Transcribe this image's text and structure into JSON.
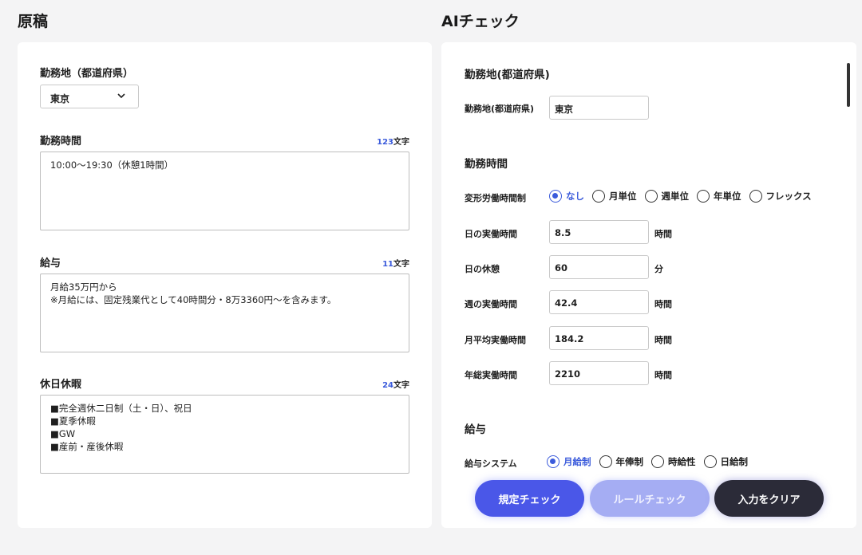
{
  "left": {
    "title": "原稿",
    "location": {
      "label": "勤務地（都道府県）",
      "value": "東京"
    },
    "hours": {
      "label": "勤務時間",
      "count_num": "123",
      "count_unit": "文字",
      "text": "10:00〜19:30（休憩1時間）"
    },
    "salary": {
      "label": "給与",
      "count_num": "11",
      "count_unit": "文字",
      "text": "月給35万円から\n※月給には、固定残業代として40時間分・8万3360円〜を含みます。"
    },
    "holidays": {
      "label": "休日休暇",
      "count_num": "24",
      "count_unit": "文字",
      "text": "■完全週休二日制（土・日）、祝日\n■夏季休暇\n■GW\n■産前・産後休暇"
    }
  },
  "right": {
    "title": "AIチェック",
    "location_section": "勤務地(都道府県)",
    "location_label": "勤務地(都道府県)",
    "location_value": "東京",
    "hours_section": "勤務時間",
    "variable_label": "変形労働時間制",
    "variable_options": [
      "なし",
      "月単位",
      "週単位",
      "年単位",
      "フレックス"
    ],
    "variable_selected": "なし",
    "fields": [
      {
        "label": "日の実働時間",
        "value": "8.5",
        "unit": "時間"
      },
      {
        "label": "日の休憩",
        "value": "60",
        "unit": "分"
      },
      {
        "label": "週の実働時間",
        "value": "42.4",
        "unit": "時間"
      },
      {
        "label": "月平均実働時間",
        "value": "184.2",
        "unit": "時間"
      },
      {
        "label": "年総実働時間",
        "value": "2210",
        "unit": "時間"
      }
    ],
    "salary_section": "給与",
    "salary_system_label": "給与システム",
    "salary_options": [
      "月給制",
      "年俸制",
      "時給性",
      "日給制"
    ],
    "salary_selected": "月給制"
  },
  "buttons": {
    "check": "規定チェック",
    "rule": "ルールチェック",
    "clear": "入力をクリア"
  },
  "colors": {
    "accent": "#3b5bdb",
    "primary_button": "#4a57e8",
    "disabled_button": "#a5adf3",
    "dark_button": "#2b2b38"
  }
}
